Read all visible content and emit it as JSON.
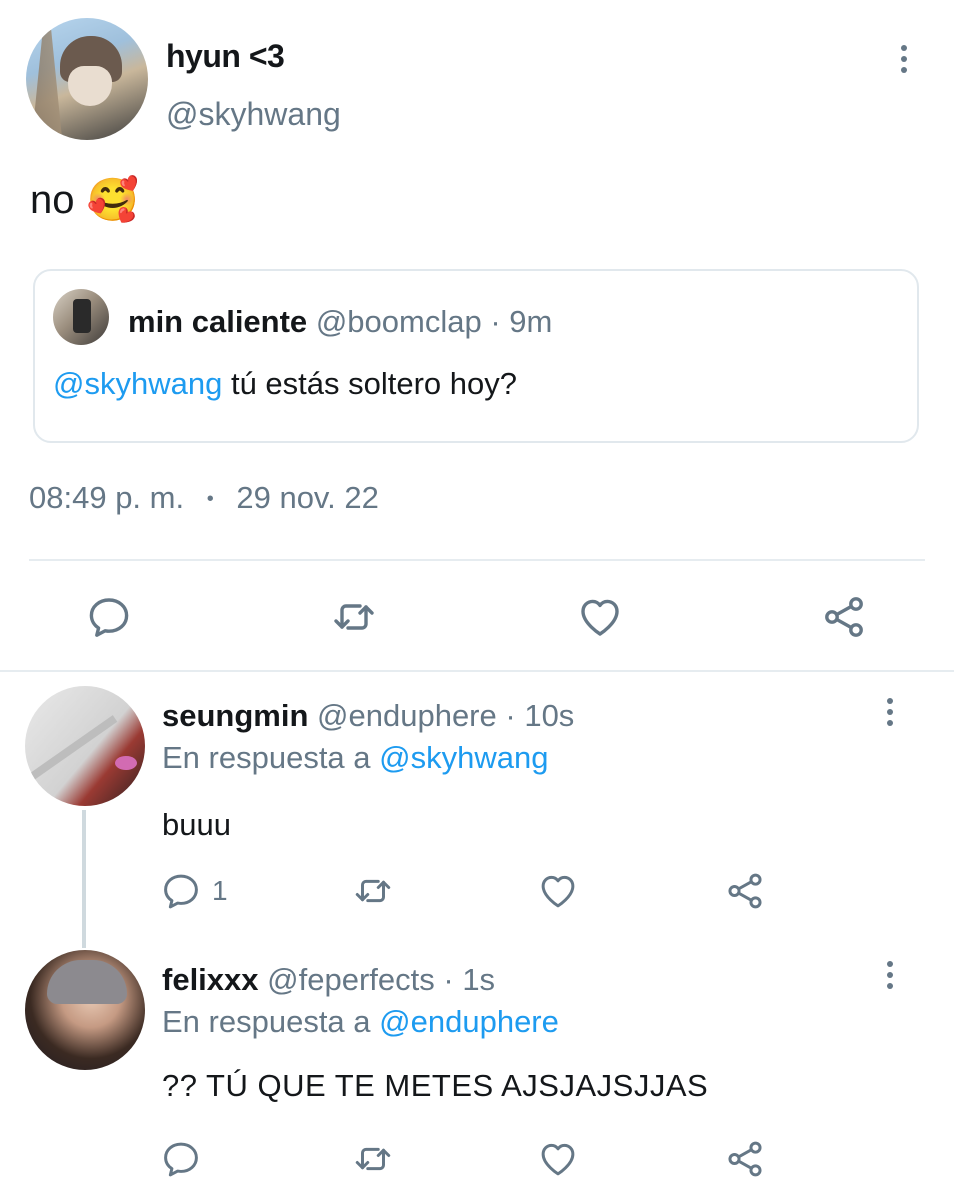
{
  "main_tweet": {
    "display_name": "hyun <3",
    "handle": "@skyhwang",
    "text": "no",
    "emoji": "🥰",
    "time": "08:49 p. m.",
    "separator": "•",
    "date": "29 nov. 22",
    "quoted": {
      "display_name": "min caliente",
      "handle": "@boomclap",
      "dot": "·",
      "age": "9m",
      "mention": "@skyhwang",
      "text": "tú estás soltero hoy?"
    }
  },
  "replies": [
    {
      "display_name": "seungmin",
      "handle": "@enduphere",
      "dot": "·",
      "age": "10s",
      "reply_to_prefix": "En respuesta a",
      "reply_to": "@skyhwang",
      "text": "buuu",
      "reply_count": "1"
    },
    {
      "display_name": "felixxx",
      "handle": "@feperfects",
      "dot": "·",
      "age": "1s",
      "reply_to_prefix": "En respuesta a",
      "reply_to": "@enduphere",
      "text": "?? TÚ QUE TE METES AJSJAJSJJAS",
      "reply_count": ""
    }
  ],
  "icons": [
    "more-vertical-icon",
    "reply-icon",
    "retweet-icon",
    "like-icon",
    "share-icon"
  ],
  "colors": {
    "link": "#1d9bf0",
    "muted": "#657786",
    "border": "#e1e8ed"
  }
}
